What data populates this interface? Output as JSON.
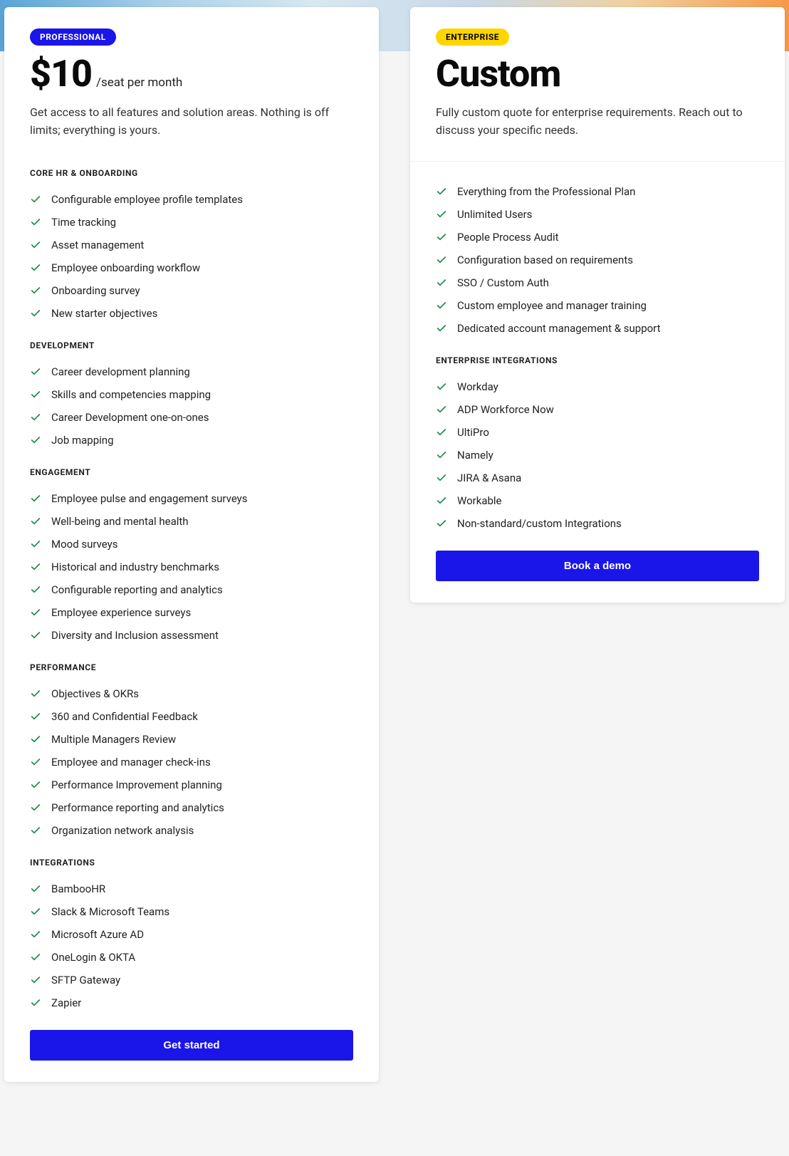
{
  "professional": {
    "badge": "PROFESSIONAL",
    "price": "$10",
    "price_unit": "/seat per month",
    "desc": "Get access to all features and solution areas. Nothing is off limits; everything is yours.",
    "sections": [
      {
        "title": "CORE HR & ONBOARDING",
        "items": [
          "Configurable employee profile templates",
          "Time tracking",
          "Asset management",
          "Employee onboarding workflow",
          "Onboarding survey",
          "New starter objectives"
        ]
      },
      {
        "title": "DEVELOPMENT",
        "items": [
          "Career development planning",
          "Skills and competencies mapping",
          "Career Development one-on-ones",
          "Job mapping"
        ]
      },
      {
        "title": "ENGAGEMENT",
        "items": [
          "Employee pulse and engagement surveys",
          "Well-being and mental health",
          "Mood surveys",
          "Historical and industry benchmarks",
          "Configurable reporting and analytics",
          "Employee experience surveys",
          "Diversity and Inclusion assessment"
        ]
      },
      {
        "title": "PERFORMANCE",
        "items": [
          "Objectives & OKRs",
          "360 and Confidential Feedback",
          "Multiple Managers Review",
          "Employee and manager check-ins",
          "Performance Improvement planning",
          "Performance reporting and analytics",
          "Organization network analysis"
        ]
      },
      {
        "title": "INTEGRATIONS",
        "items": [
          "BambooHR",
          "Slack & Microsoft Teams",
          "Microsoft Azure AD",
          "OneLogin & OKTA",
          "SFTP Gateway",
          "Zapier"
        ]
      }
    ],
    "cta": "Get started"
  },
  "enterprise": {
    "badge": "ENTERPRISE",
    "title": "Custom",
    "desc": "Fully custom quote for enterprise requirements. Reach out to discuss your specific needs.",
    "sections": [
      {
        "title": "",
        "items": [
          "Everything from the Professional Plan",
          "Unlimited Users",
          "People Process Audit",
          "Configuration based on requirements",
          "SSO / Custom Auth",
          "Custom employee and manager training",
          "Dedicated account management & support"
        ]
      },
      {
        "title": "ENTERPRISE INTEGRATIONS",
        "items": [
          "Workday",
          "ADP Workforce Now",
          "UltiPro",
          "Namely",
          "JIRA & Asana",
          "Workable",
          "Non-standard/custom Integrations"
        ]
      }
    ],
    "cta": "Book a demo"
  }
}
